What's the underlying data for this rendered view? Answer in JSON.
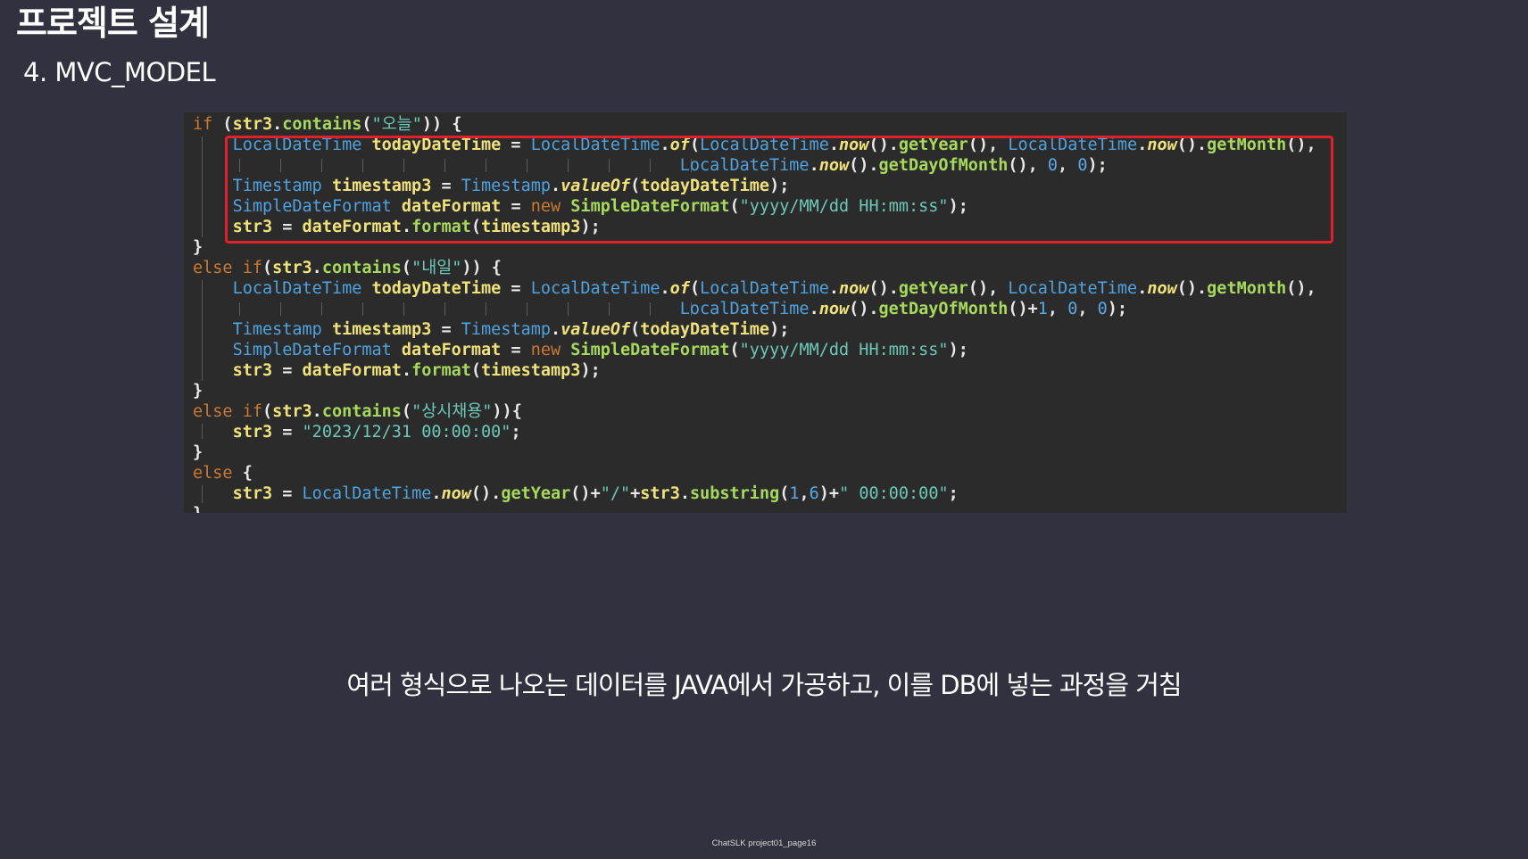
{
  "slide": {
    "title": "프로젝트 설계",
    "subtitle": "4. MVC_MODEL",
    "caption": "여러 형식으로 나오는 데이터를 JAVA에서 가공하고, 이를 DB에 넣는 과정을 거침",
    "footer": "ChatSLK project01_page16"
  },
  "colors": {
    "background": "#32313f",
    "code_background": "#2b2b2b",
    "highlight_border": "#e0202a",
    "keyword": "#cc7832",
    "type": "#4fa3e0",
    "variable": "#f0e27a",
    "method": "#a6d95c",
    "string": "#6cc9b8"
  },
  "code_lines": [
    [
      [
        "kw",
        "if "
      ],
      [
        "pl",
        "("
      ],
      [
        "vn",
        "str3"
      ],
      [
        "pl",
        "."
      ],
      [
        "mt",
        "contains"
      ],
      [
        "pl",
        "("
      ],
      [
        "st",
        "\"오늘\""
      ],
      [
        "pl",
        ")) {"
      ]
    ],
    [
      [
        "pl",
        "    "
      ],
      [
        "ty",
        "LocalDateTime "
      ],
      [
        "vn",
        "todayDateTime"
      ],
      [
        "pl",
        " = "
      ],
      [
        "ty",
        "LocalDateTime"
      ],
      [
        "pl",
        "."
      ],
      [
        "it",
        "of"
      ],
      [
        "pl",
        "("
      ],
      [
        "ty",
        "LocalDateTime"
      ],
      [
        "pl",
        "."
      ],
      [
        "it",
        "now"
      ],
      [
        "pl",
        "()."
      ],
      [
        "mt",
        "getYear"
      ],
      [
        "pl",
        "(), "
      ],
      [
        "ty",
        "LocalDateTime"
      ],
      [
        "pl",
        "."
      ],
      [
        "it",
        "now"
      ],
      [
        "pl",
        "()."
      ],
      [
        "mt",
        "getMonth"
      ],
      [
        "pl",
        "(),"
      ]
    ],
    [
      [
        "pl",
        "                                                 "
      ],
      [
        "ty",
        "LocalDateTime"
      ],
      [
        "pl",
        "."
      ],
      [
        "it",
        "now"
      ],
      [
        "pl",
        "()."
      ],
      [
        "mt",
        "getDayOfMonth"
      ],
      [
        "pl",
        "(), "
      ],
      [
        "nm",
        "0"
      ],
      [
        "pl",
        ", "
      ],
      [
        "nm",
        "0"
      ],
      [
        "pl",
        ");"
      ]
    ],
    [
      [
        "pl",
        "    "
      ],
      [
        "ty",
        "Timestamp "
      ],
      [
        "vn",
        "timestamp3"
      ],
      [
        "pl",
        " = "
      ],
      [
        "ty",
        "Timestamp"
      ],
      [
        "pl",
        "."
      ],
      [
        "it",
        "valueOf"
      ],
      [
        "pl",
        "("
      ],
      [
        "vn",
        "todayDateTime"
      ],
      [
        "pl",
        ");"
      ]
    ],
    [
      [
        "pl",
        "    "
      ],
      [
        "ty",
        "SimpleDateFormat "
      ],
      [
        "vn",
        "dateFormat"
      ],
      [
        "pl",
        " = "
      ],
      [
        "kw",
        "new "
      ],
      [
        "mt",
        "SimpleDateFormat"
      ],
      [
        "pl",
        "("
      ],
      [
        "st",
        "\"yyyy/MM/dd HH:mm:ss\""
      ],
      [
        "pl",
        ");"
      ]
    ],
    [
      [
        "pl",
        "    "
      ],
      [
        "vn",
        "str3"
      ],
      [
        "pl",
        " = "
      ],
      [
        "vn",
        "dateFormat"
      ],
      [
        "pl",
        "."
      ],
      [
        "mt",
        "format"
      ],
      [
        "pl",
        "("
      ],
      [
        "vn",
        "timestamp3"
      ],
      [
        "pl",
        ");"
      ]
    ],
    [
      [
        "pl",
        "}"
      ]
    ],
    [
      [
        "kw",
        "else if"
      ],
      [
        "pl",
        "("
      ],
      [
        "vn",
        "str3"
      ],
      [
        "pl",
        "."
      ],
      [
        "mt",
        "contains"
      ],
      [
        "pl",
        "("
      ],
      [
        "st",
        "\"내일\""
      ],
      [
        "pl",
        ")) {"
      ]
    ],
    [
      [
        "pl",
        "    "
      ],
      [
        "ty",
        "LocalDateTime "
      ],
      [
        "vn",
        "todayDateTime"
      ],
      [
        "pl",
        " = "
      ],
      [
        "ty",
        "LocalDateTime"
      ],
      [
        "pl",
        "."
      ],
      [
        "it",
        "of"
      ],
      [
        "pl",
        "("
      ],
      [
        "ty",
        "LocalDateTime"
      ],
      [
        "pl",
        "."
      ],
      [
        "it",
        "now"
      ],
      [
        "pl",
        "()."
      ],
      [
        "mt",
        "getYear"
      ],
      [
        "pl",
        "(), "
      ],
      [
        "ty",
        "LocalDateTime"
      ],
      [
        "pl",
        "."
      ],
      [
        "it",
        "now"
      ],
      [
        "pl",
        "()."
      ],
      [
        "mt",
        "getMonth"
      ],
      [
        "pl",
        "(),"
      ]
    ],
    [
      [
        "pl",
        "                                                 "
      ],
      [
        "ty",
        "LocalDateTime"
      ],
      [
        "pl",
        "."
      ],
      [
        "it",
        "now"
      ],
      [
        "pl",
        "()."
      ],
      [
        "mt",
        "getDayOfMonth"
      ],
      [
        "pl",
        "()+"
      ],
      [
        "nm",
        "1"
      ],
      [
        "pl",
        ", "
      ],
      [
        "nm",
        "0"
      ],
      [
        "pl",
        ", "
      ],
      [
        "nm",
        "0"
      ],
      [
        "pl",
        ");"
      ]
    ],
    [
      [
        "pl",
        "    "
      ],
      [
        "ty",
        "Timestamp "
      ],
      [
        "vn",
        "timestamp3"
      ],
      [
        "pl",
        " = "
      ],
      [
        "ty",
        "Timestamp"
      ],
      [
        "pl",
        "."
      ],
      [
        "it",
        "valueOf"
      ],
      [
        "pl",
        "("
      ],
      [
        "vn",
        "todayDateTime"
      ],
      [
        "pl",
        ");"
      ]
    ],
    [
      [
        "pl",
        "    "
      ],
      [
        "ty",
        "SimpleDateFormat "
      ],
      [
        "vn",
        "dateFormat"
      ],
      [
        "pl",
        " = "
      ],
      [
        "kw",
        "new "
      ],
      [
        "mt",
        "SimpleDateFormat"
      ],
      [
        "pl",
        "("
      ],
      [
        "st",
        "\"yyyy/MM/dd HH:mm:ss\""
      ],
      [
        "pl",
        ");"
      ]
    ],
    [
      [
        "pl",
        "    "
      ],
      [
        "vn",
        "str3"
      ],
      [
        "pl",
        " = "
      ],
      [
        "vn",
        "dateFormat"
      ],
      [
        "pl",
        "."
      ],
      [
        "mt",
        "format"
      ],
      [
        "pl",
        "("
      ],
      [
        "vn",
        "timestamp3"
      ],
      [
        "pl",
        ");"
      ]
    ],
    [
      [
        "pl",
        "}"
      ]
    ],
    [
      [
        "kw",
        "else if"
      ],
      [
        "pl",
        "("
      ],
      [
        "vn",
        "str3"
      ],
      [
        "pl",
        "."
      ],
      [
        "mt",
        "contains"
      ],
      [
        "pl",
        "("
      ],
      [
        "st",
        "\"상시채용\""
      ],
      [
        "pl",
        "))"
      ],
      [
        "pl",
        "{"
      ]
    ],
    [
      [
        "pl",
        "    "
      ],
      [
        "vn",
        "str3"
      ],
      [
        "pl",
        " = "
      ],
      [
        "st",
        "\"2023/12/31 00:00:00\""
      ],
      [
        "pl",
        ";"
      ]
    ],
    [
      [
        "pl",
        "}"
      ]
    ],
    [
      [
        "kw",
        "else "
      ],
      [
        "pl",
        "{"
      ]
    ],
    [
      [
        "pl",
        "    "
      ],
      [
        "vn",
        "str3"
      ],
      [
        "pl",
        " = "
      ],
      [
        "ty",
        "LocalDateTime"
      ],
      [
        "pl",
        "."
      ],
      [
        "it",
        "now"
      ],
      [
        "pl",
        "()."
      ],
      [
        "mt",
        "getYear"
      ],
      [
        "pl",
        "()+"
      ],
      [
        "st",
        "\"/\""
      ],
      [
        "pl",
        "+"
      ],
      [
        "vn",
        "str3"
      ],
      [
        "pl",
        "."
      ],
      [
        "mt",
        "substring"
      ],
      [
        "pl",
        "("
      ],
      [
        "nm",
        "1"
      ],
      [
        "pl",
        ","
      ],
      [
        "nm",
        "6"
      ],
      [
        "pl",
        ")+"
      ],
      [
        "st",
        "\" 00:00:00\""
      ],
      [
        "pl",
        ";"
      ]
    ],
    [
      [
        "pl",
        "}"
      ]
    ]
  ]
}
